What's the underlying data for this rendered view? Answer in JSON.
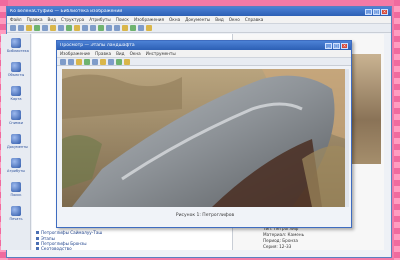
{
  "main_window": {
    "title": "Ко веленаСтуфию — Библиотека изображений",
    "menu": [
      "Файл",
      "Правка",
      "Вид",
      "Структура",
      "Атрибуты",
      "Поиск",
      "Изображения",
      "Окна",
      "Документы",
      "Вид",
      "Окно",
      "Справка"
    ]
  },
  "viewer": {
    "title": "Просмотр — Этапы ландшафта",
    "menu": [
      "Изображение",
      "Правка",
      "Вид",
      "Окна",
      "Инструменты"
    ],
    "caption": "Рисунок 1: Петроглифов"
  },
  "sidebar": {
    "items": [
      {
        "label": "Библиотека"
      },
      {
        "label": "Объекты"
      },
      {
        "label": "Карта"
      },
      {
        "label": "Снимки"
      },
      {
        "label": "Документы"
      },
      {
        "label": "Атрибуты"
      },
      {
        "label": "Поиск"
      },
      {
        "label": "Печать"
      }
    ]
  },
  "tree": {
    "items": [
      {
        "label": "Петроглифы Саймалуу-Таш"
      },
      {
        "label": "Этапы"
      },
      {
        "label": "Петроглифы Бронзы"
      },
      {
        "label": "Скотоводство"
      }
    ]
  },
  "right_panel": {
    "lines": [
      "Тип: Петроглиф",
      "Материал: Камень",
      "Период: Бронза",
      "Серия: 12-33"
    ]
  }
}
